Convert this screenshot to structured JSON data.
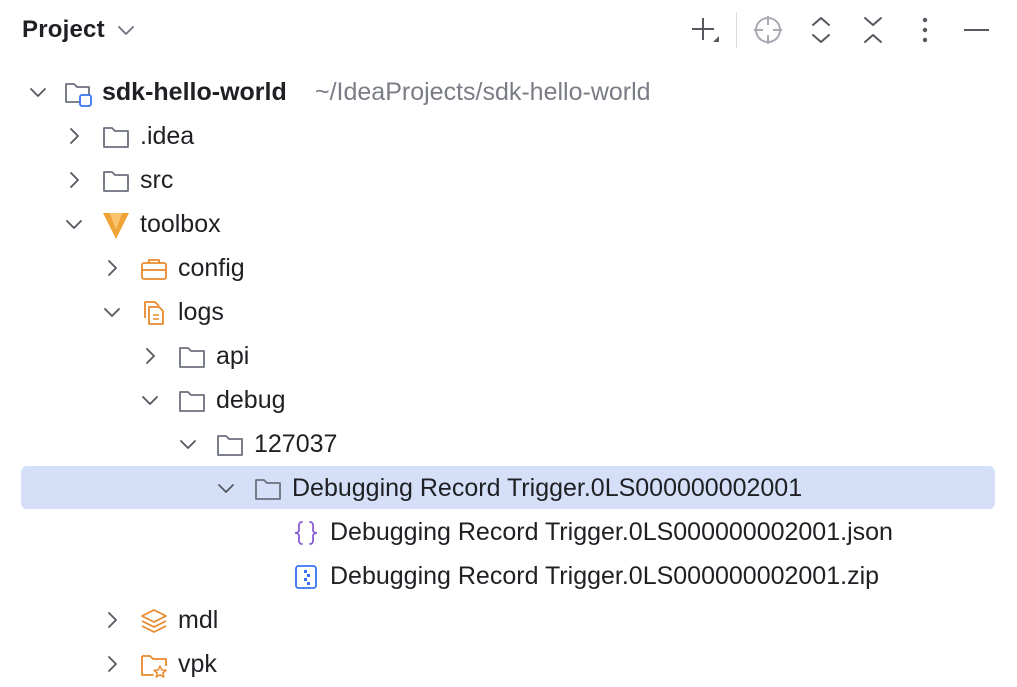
{
  "panel": {
    "title": "Project",
    "toolbar": [
      {
        "name": "new-file-icon"
      },
      {
        "name": "locate-icon"
      },
      {
        "name": "expand-all-icon"
      },
      {
        "name": "collapse-all-icon"
      },
      {
        "name": "more-options-icon"
      },
      {
        "name": "hide-panel-icon"
      }
    ]
  },
  "tree": [
    {
      "label": "sdk-hello-world",
      "path": "~/IdeaProjects/sdk-hello-world",
      "expanded": true,
      "icon": "module-folder-icon"
    },
    {
      "label": ".idea",
      "expanded": false,
      "icon": "folder-icon"
    },
    {
      "label": "src",
      "expanded": false,
      "icon": "folder-icon"
    },
    {
      "label": "toolbox",
      "expanded": true,
      "icon": "vault-logo-icon"
    },
    {
      "label": "config",
      "expanded": false,
      "icon": "briefcase-icon"
    },
    {
      "label": "logs",
      "expanded": true,
      "icon": "logs-icon"
    },
    {
      "label": "api",
      "expanded": false,
      "icon": "folder-icon"
    },
    {
      "label": "debug",
      "expanded": true,
      "icon": "folder-icon"
    },
    {
      "label": "127037",
      "expanded": true,
      "icon": "folder-icon"
    },
    {
      "label": "Debugging Record Trigger.0LS000000002001",
      "expanded": true,
      "selected": true,
      "icon": "folder-icon"
    },
    {
      "label": "Debugging Record Trigger.0LS000000002001.json",
      "icon": "json-file-icon"
    },
    {
      "label": "Debugging Record Trigger.0LS000000002001.zip",
      "icon": "zip-file-icon"
    },
    {
      "label": "mdl",
      "expanded": false,
      "icon": "layers-icon"
    },
    {
      "label": "vpk",
      "expanded": false,
      "icon": "package-folder-icon"
    }
  ]
}
